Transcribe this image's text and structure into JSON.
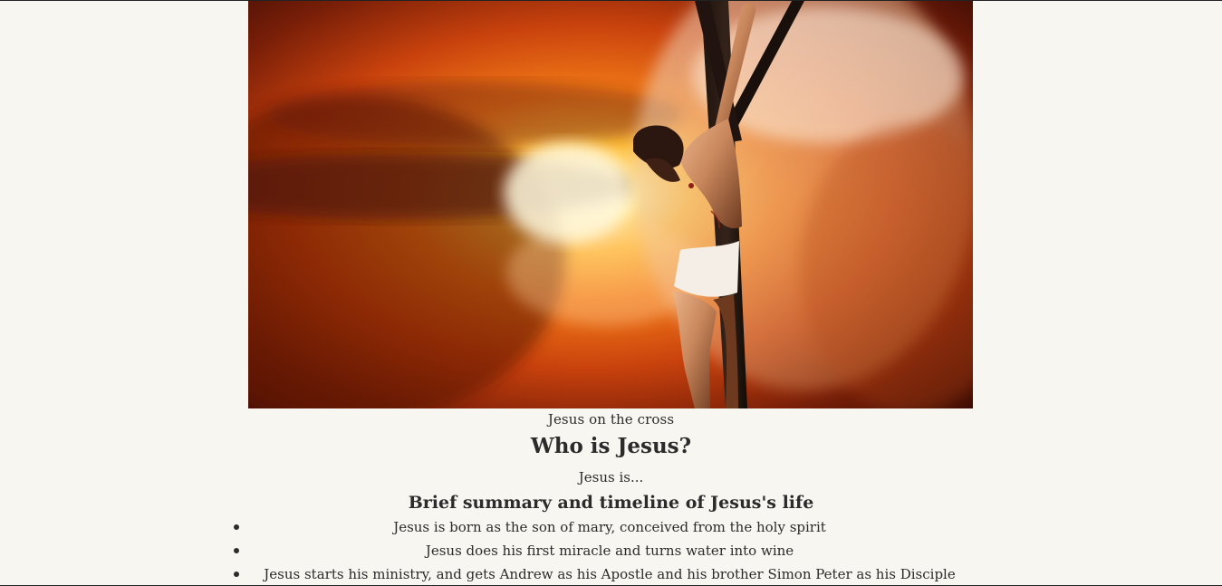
{
  "hero_image": {
    "caption": "Jesus on the cross"
  },
  "main": {
    "title": "Who is Jesus?",
    "intro": "Jesus is...",
    "timeline_heading": "Brief summary and timeline of Jesus's life",
    "timeline_items": [
      "Jesus is born as the son of mary, conceived from the holy spirit",
      "Jesus does his first miracle and turns water into wine",
      "Jesus starts his ministry, and gets Andrew as his Apostle and his brother Simon Peter as his Disciple"
    ]
  }
}
